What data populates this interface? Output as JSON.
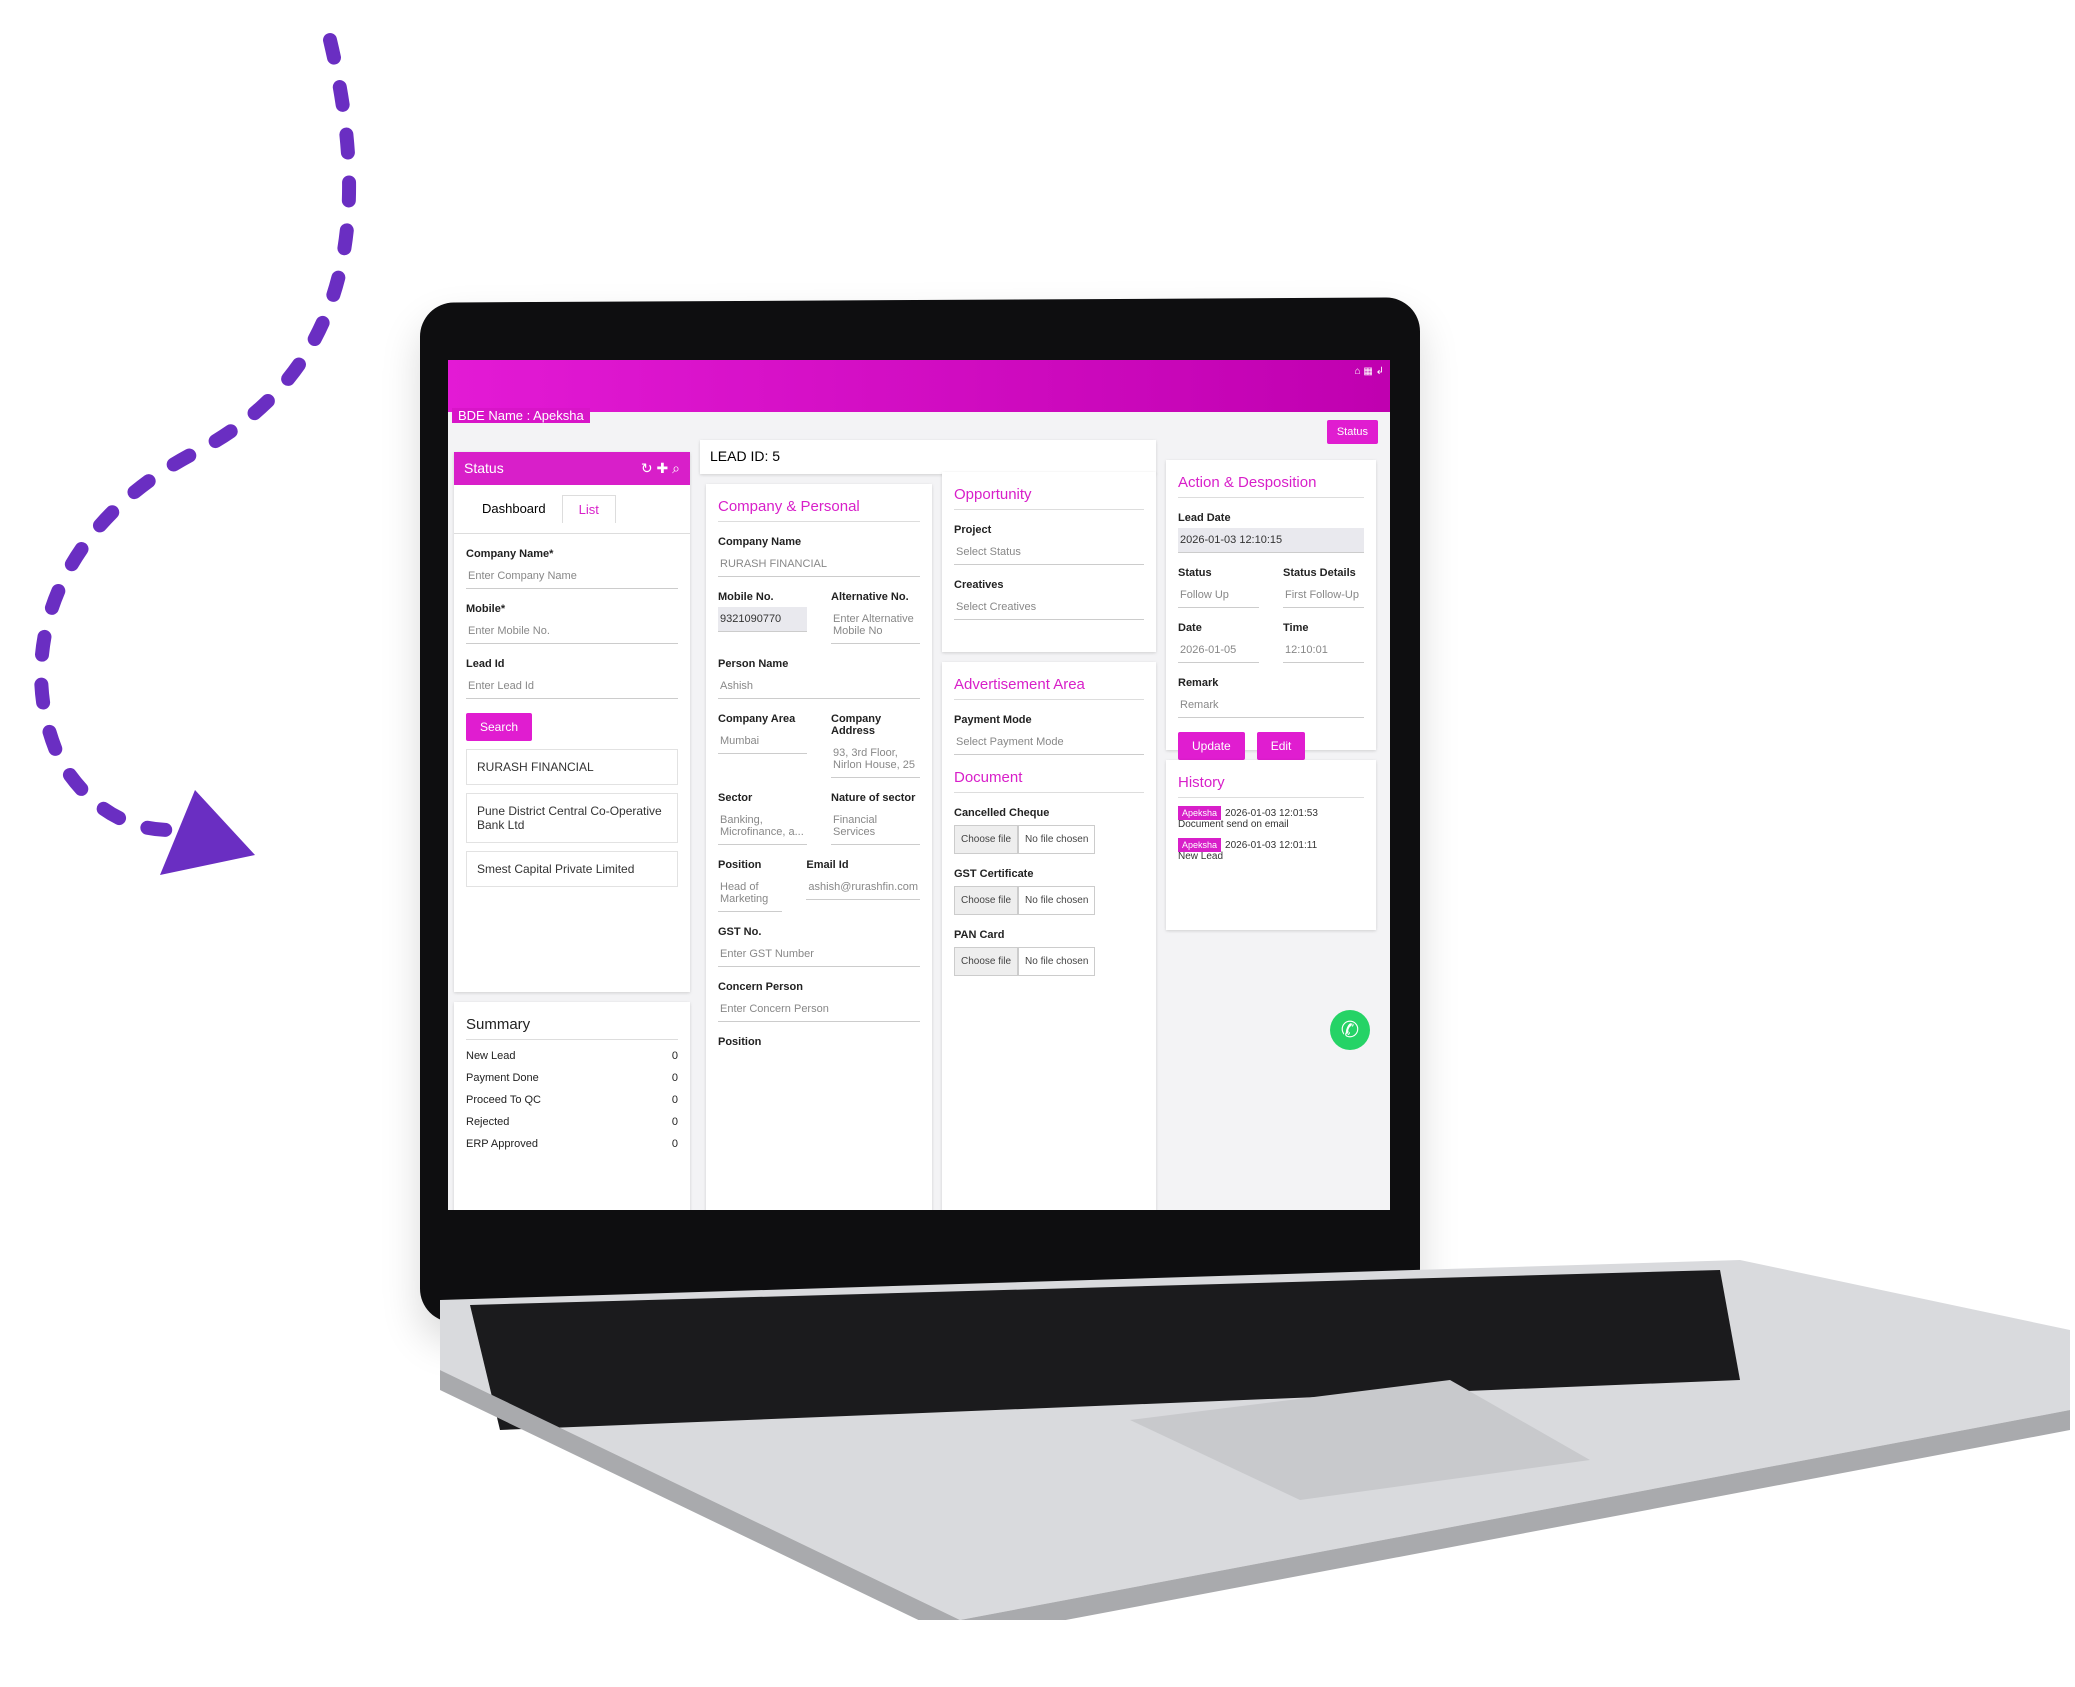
{
  "app": {
    "bde_name": "BDE Name : Apeksha",
    "status_button": "Status",
    "system_icons": "⌂ ▦ ↲"
  },
  "sidebar": {
    "header": "Status",
    "header_icons": "↻ ✚ ⌕",
    "tabs": [
      "Dashboard",
      "List"
    ],
    "fields": [
      {
        "label": "Company Name*",
        "placeholder": "Enter Company Name"
      },
      {
        "label": "Mobile*",
        "placeholder": "Enter Mobile No."
      },
      {
        "label": "Lead Id",
        "placeholder": "Enter Lead Id"
      }
    ],
    "search_button": "Search",
    "results": [
      "RURASH FINANCIAL",
      "Pune District Central Co-Operative Bank Ltd",
      "Smest Capital Private Limited"
    ]
  },
  "summary": {
    "title": "Summary",
    "rows": [
      {
        "label": "New Lead",
        "count": "0"
      },
      {
        "label": "Payment Done",
        "count": "0"
      },
      {
        "label": "Proceed To QC",
        "count": "0"
      },
      {
        "label": "Rejected",
        "count": "0"
      },
      {
        "label": "ERP Approved",
        "count": "0"
      }
    ]
  },
  "lead": {
    "id_label": "LEAD ID: 5"
  },
  "company": {
    "title": "Company & Personal",
    "company_name_label": "Company Name",
    "company_name": "RURASH FINANCIAL",
    "mobile_label": "Mobile No.",
    "mobile": "9321090770",
    "alt_label": "Alternative No.",
    "alt_placeholder": "Enter Alternative Mobile No",
    "person_label": "Person Name",
    "person": "Ashish",
    "area_label": "Company Area",
    "area": "Mumbai",
    "address_label": "Company Address",
    "address": "93, 3rd Floor, Nirlon House, 25",
    "sector_label": "Sector",
    "sector": "Banking, Microfinance, a...",
    "nature_label": "Nature of sector",
    "nature": "Financial Services",
    "position_label": "Position",
    "position": "Head of Marketing",
    "email_label": "Email Id",
    "email": "ashish@rurashfin.com",
    "gst_label": "GST No.",
    "gst_placeholder": "Enter GST Number",
    "concern_label": "Concern Person",
    "concern_placeholder": "Enter Concern Person",
    "position2_label": "Position"
  },
  "opportunity": {
    "title": "Opportunity",
    "project_label": "Project",
    "project": "Select Status",
    "creatives_label": "Creatives",
    "creatives": "Select Creatives"
  },
  "advertisement": {
    "title": "Advertisement Area",
    "payment_label": "Payment Mode",
    "payment": "Select Payment Mode"
  },
  "document": {
    "title": "Document",
    "choose": "Choose file",
    "none": "No file chosen",
    "items": [
      "Cancelled Cheque",
      "GST Certificate",
      "PAN Card"
    ]
  },
  "action": {
    "title": "Action & Desposition",
    "lead_date_label": "Lead Date",
    "lead_date": "2026-01-03 12:10:15",
    "status_label": "Status",
    "status": "Follow Up",
    "status_details_label": "Status Details",
    "status_details": "First Follow-Up",
    "date_label": "Date",
    "date": "2026-01-05",
    "time_label": "Time",
    "time": "12:10:01",
    "remark_label": "Remark",
    "remark_placeholder": "Remark",
    "update_button": "Update",
    "other_button": "Edit"
  },
  "history": {
    "title": "History",
    "entries": [
      {
        "user": "Apeksha",
        "time": "2026-01-03 12:01:53",
        "text": "Document send on email"
      },
      {
        "user": "Apeksha",
        "time": "2026-01-03 12:01:11",
        "text": "New Lead"
      }
    ]
  },
  "colors": {
    "accent": "#d81fc9",
    "arrow": "#6a2ec2",
    "whatsapp": "#25d366"
  }
}
